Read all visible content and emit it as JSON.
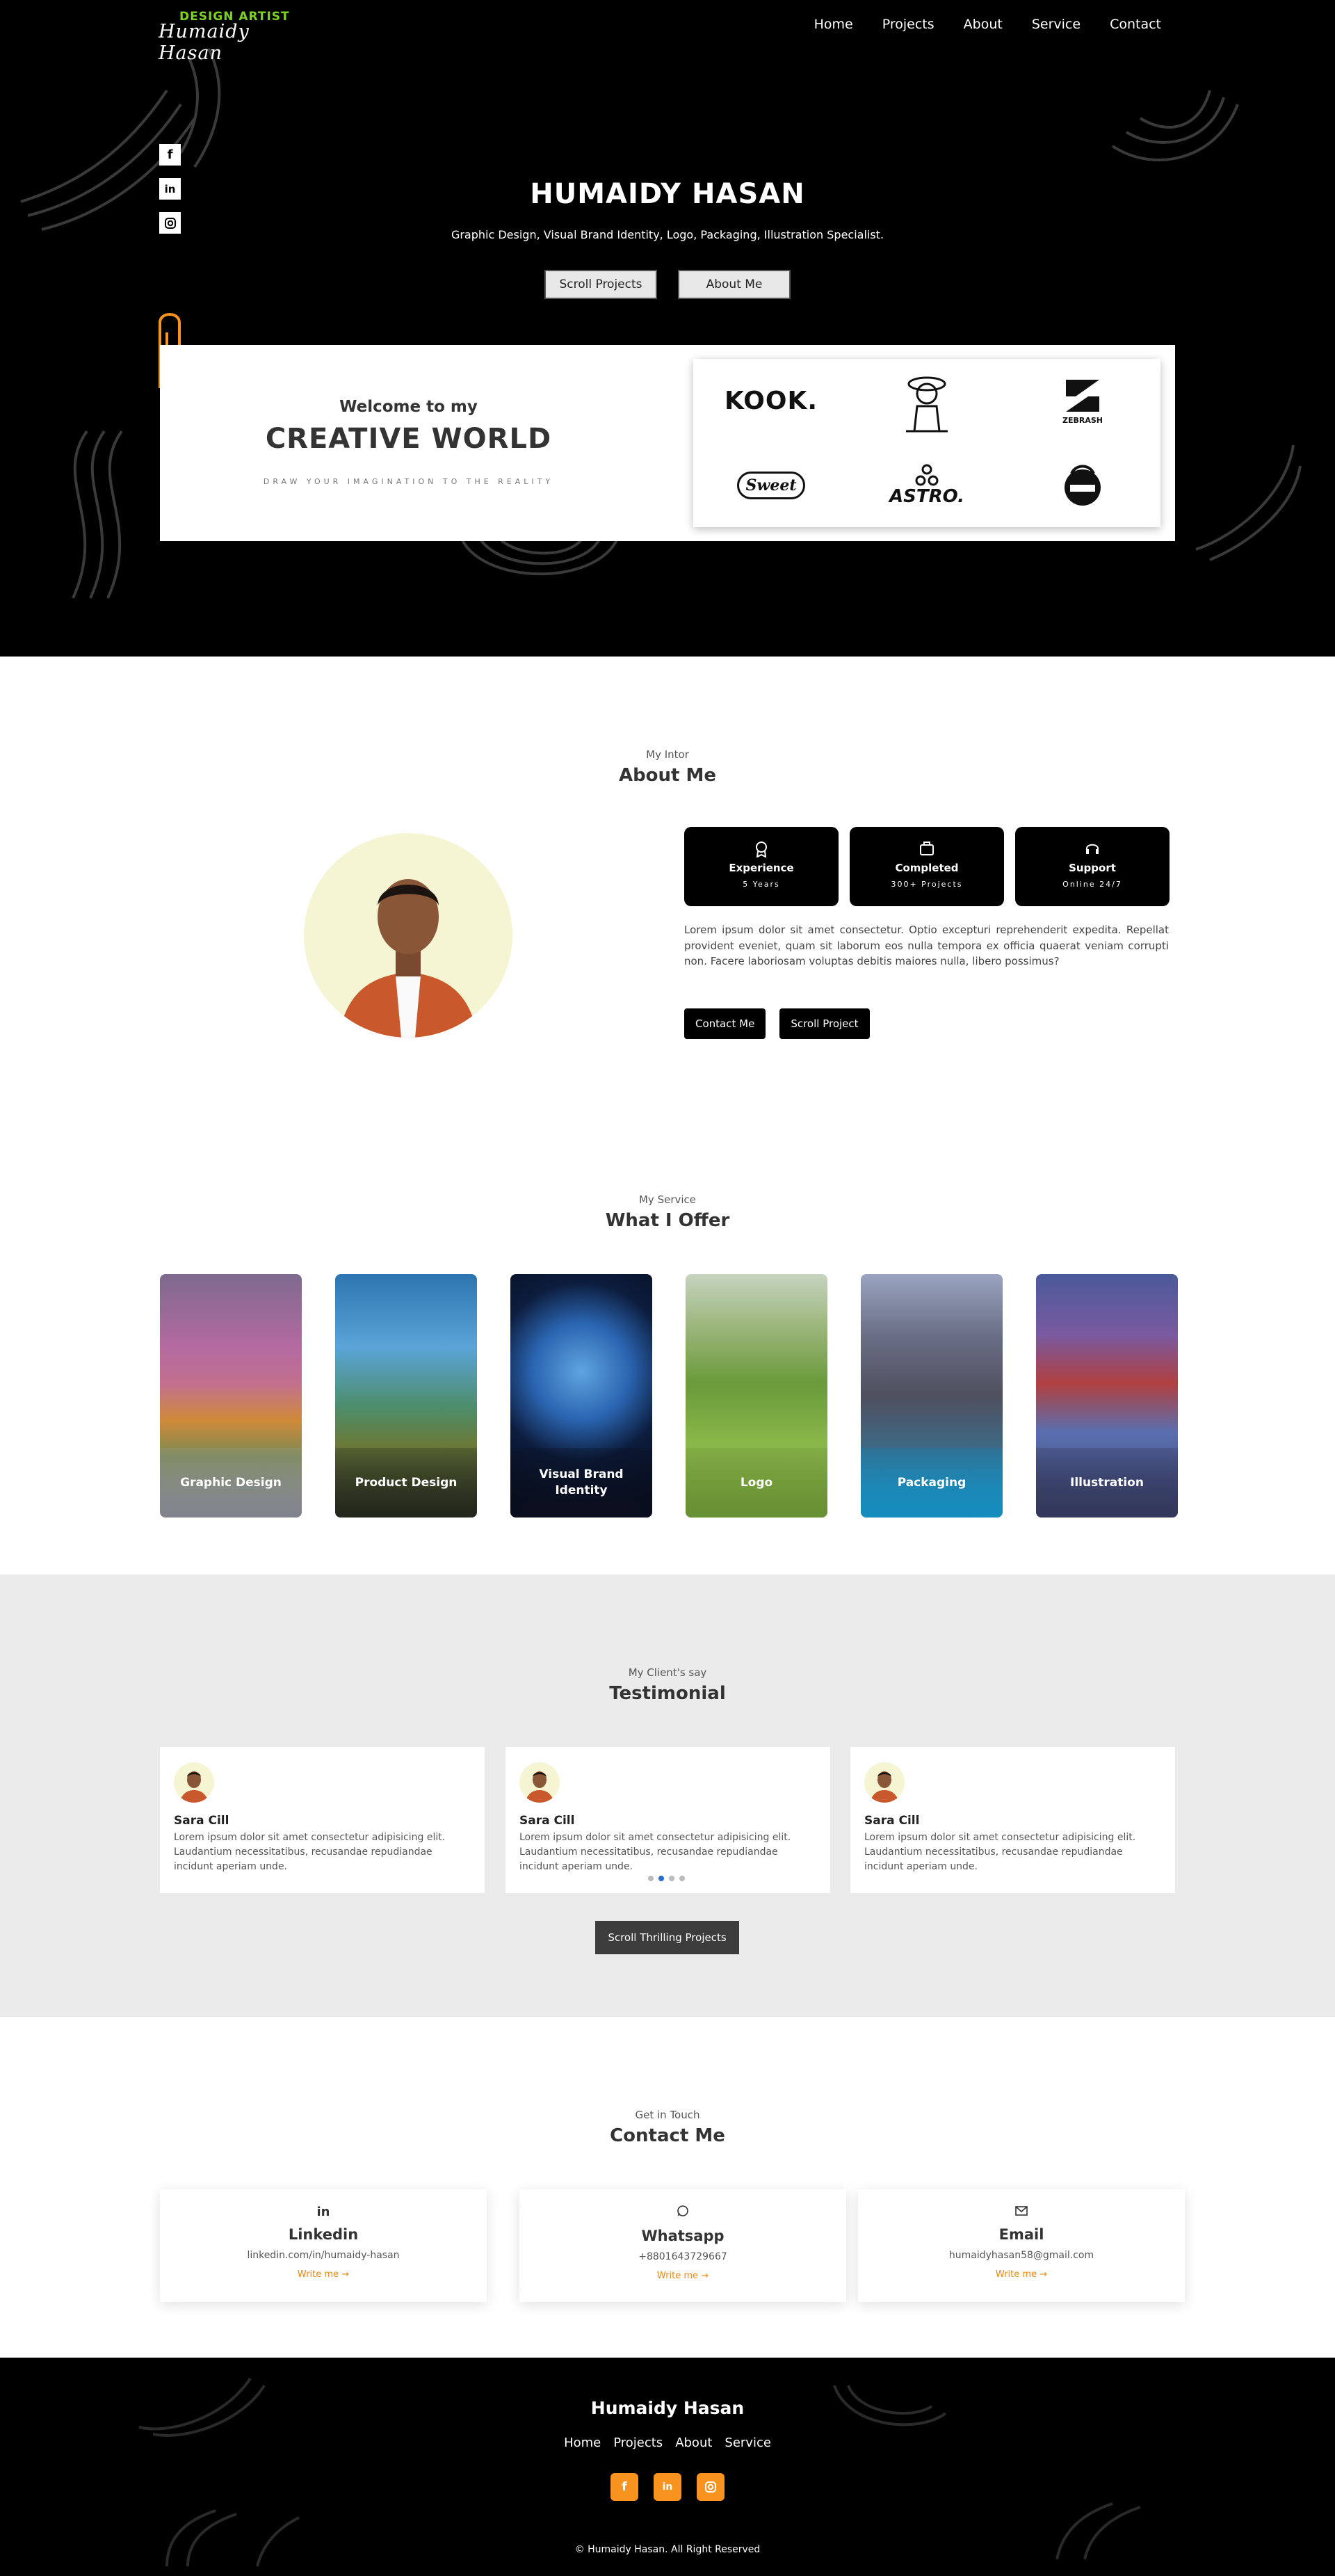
{
  "header": {
    "logo_top": "DESIGN ARTIST",
    "logo_script": "Humaidy Hasan",
    "nav": [
      "Home",
      "Projects",
      "About",
      "Service",
      "Contact"
    ]
  },
  "hero": {
    "social_icons": [
      "facebook-icon",
      "linkedin-icon",
      "instagram-icon"
    ],
    "title": "HUMAIDY HASAN",
    "subtitle": "Graphic Design, Visual Brand Identity, Logo, Packaging, Illustration Specialist.",
    "btn_projects": "Scroll Projects",
    "btn_about": "About Me"
  },
  "creative": {
    "welcome": "Welcome to my",
    "title": "CREATIVE WORLD",
    "tagline": "DRAW YOUR IMAGINATION TO THE REALITY",
    "brands": {
      "kook": "KOOK.",
      "zebrash": "ZEBRASH",
      "script": "Sweet",
      "astro": "ASTRO."
    }
  },
  "about": {
    "sub": "My Intor",
    "title": "About Me",
    "stats": [
      {
        "icon": "award-icon",
        "title": "Experience",
        "value": "5 Years"
      },
      {
        "icon": "briefcase-icon",
        "title": "Completed",
        "value": "300+ Projects"
      },
      {
        "icon": "headset-icon",
        "title": "Support",
        "value": "Online 24/7"
      }
    ],
    "text": "Lorem ipsum dolor sit amet consectetur. Optio excepturi reprehenderit expedita. Repellat provident eveniet, quam sit laborum eos nulla tempora ex officia quaerat veniam corrupti non. Facere laboriosam voluptas debitis maiores nulla, libero possimus?",
    "btn_contact": "Contact Me",
    "btn_project": "Scroll Project"
  },
  "services": {
    "sub": "My Service",
    "title": "What I Offer",
    "items": [
      "Graphic Design",
      "Product Design",
      "Visual Brand Identity",
      "Logo",
      "Packaging",
      "Illustration"
    ]
  },
  "testimonial": {
    "sub": "My Client's say",
    "title": "Testimonial",
    "cards": [
      {
        "name": "Sara Cill",
        "text": "Lorem ipsum dolor sit amet consectetur adipisicing elit. Laudantium necessitatibus, recusandae repudiandae incidunt aperiam unde."
      },
      {
        "name": "Sara Cill",
        "text": "Lorem ipsum dolor sit amet consectetur adipisicing elit. Laudantium necessitatibus, recusandae repudiandae incidunt aperiam unde."
      },
      {
        "name": "Sara Cill",
        "text": "Lorem ipsum dolor sit amet consectetur adipisicing elit. Laudantium necessitatibus, recusandae repudiandae incidunt aperiam unde."
      }
    ],
    "carousel_active": 2,
    "carousel_total": 4,
    "button": "Scroll Thrilling Projects"
  },
  "contact": {
    "sub": "Get in Touch",
    "title": "Contact Me",
    "cards": [
      {
        "icon": "linkedin-icon",
        "title": "Linkedin",
        "value": "linkedin.com/in/humaidy-hasan",
        "link": "Write me →"
      },
      {
        "icon": "whatsapp-icon",
        "title": "Whatsapp",
        "value": "+8801643729667",
        "link": "Write me →"
      },
      {
        "icon": "mail-icon",
        "title": "Email",
        "value": "humaidyhasan58@gmail.com",
        "link": "Write me →"
      }
    ]
  },
  "footer": {
    "name": "Humaidy Hasan",
    "nav": [
      "Home",
      "Projects",
      "About",
      "Service"
    ],
    "social_icons": [
      "facebook-icon",
      "linkedin-icon",
      "instagram-icon"
    ],
    "copyright": "© Humaidy Hasan. All Right Reserved"
  },
  "colors": {
    "accent_orange": "#f7931e",
    "logo_green": "#7ed321",
    "testimonial_bg": "#ebebeb",
    "dot_active": "#2a6ccf"
  }
}
